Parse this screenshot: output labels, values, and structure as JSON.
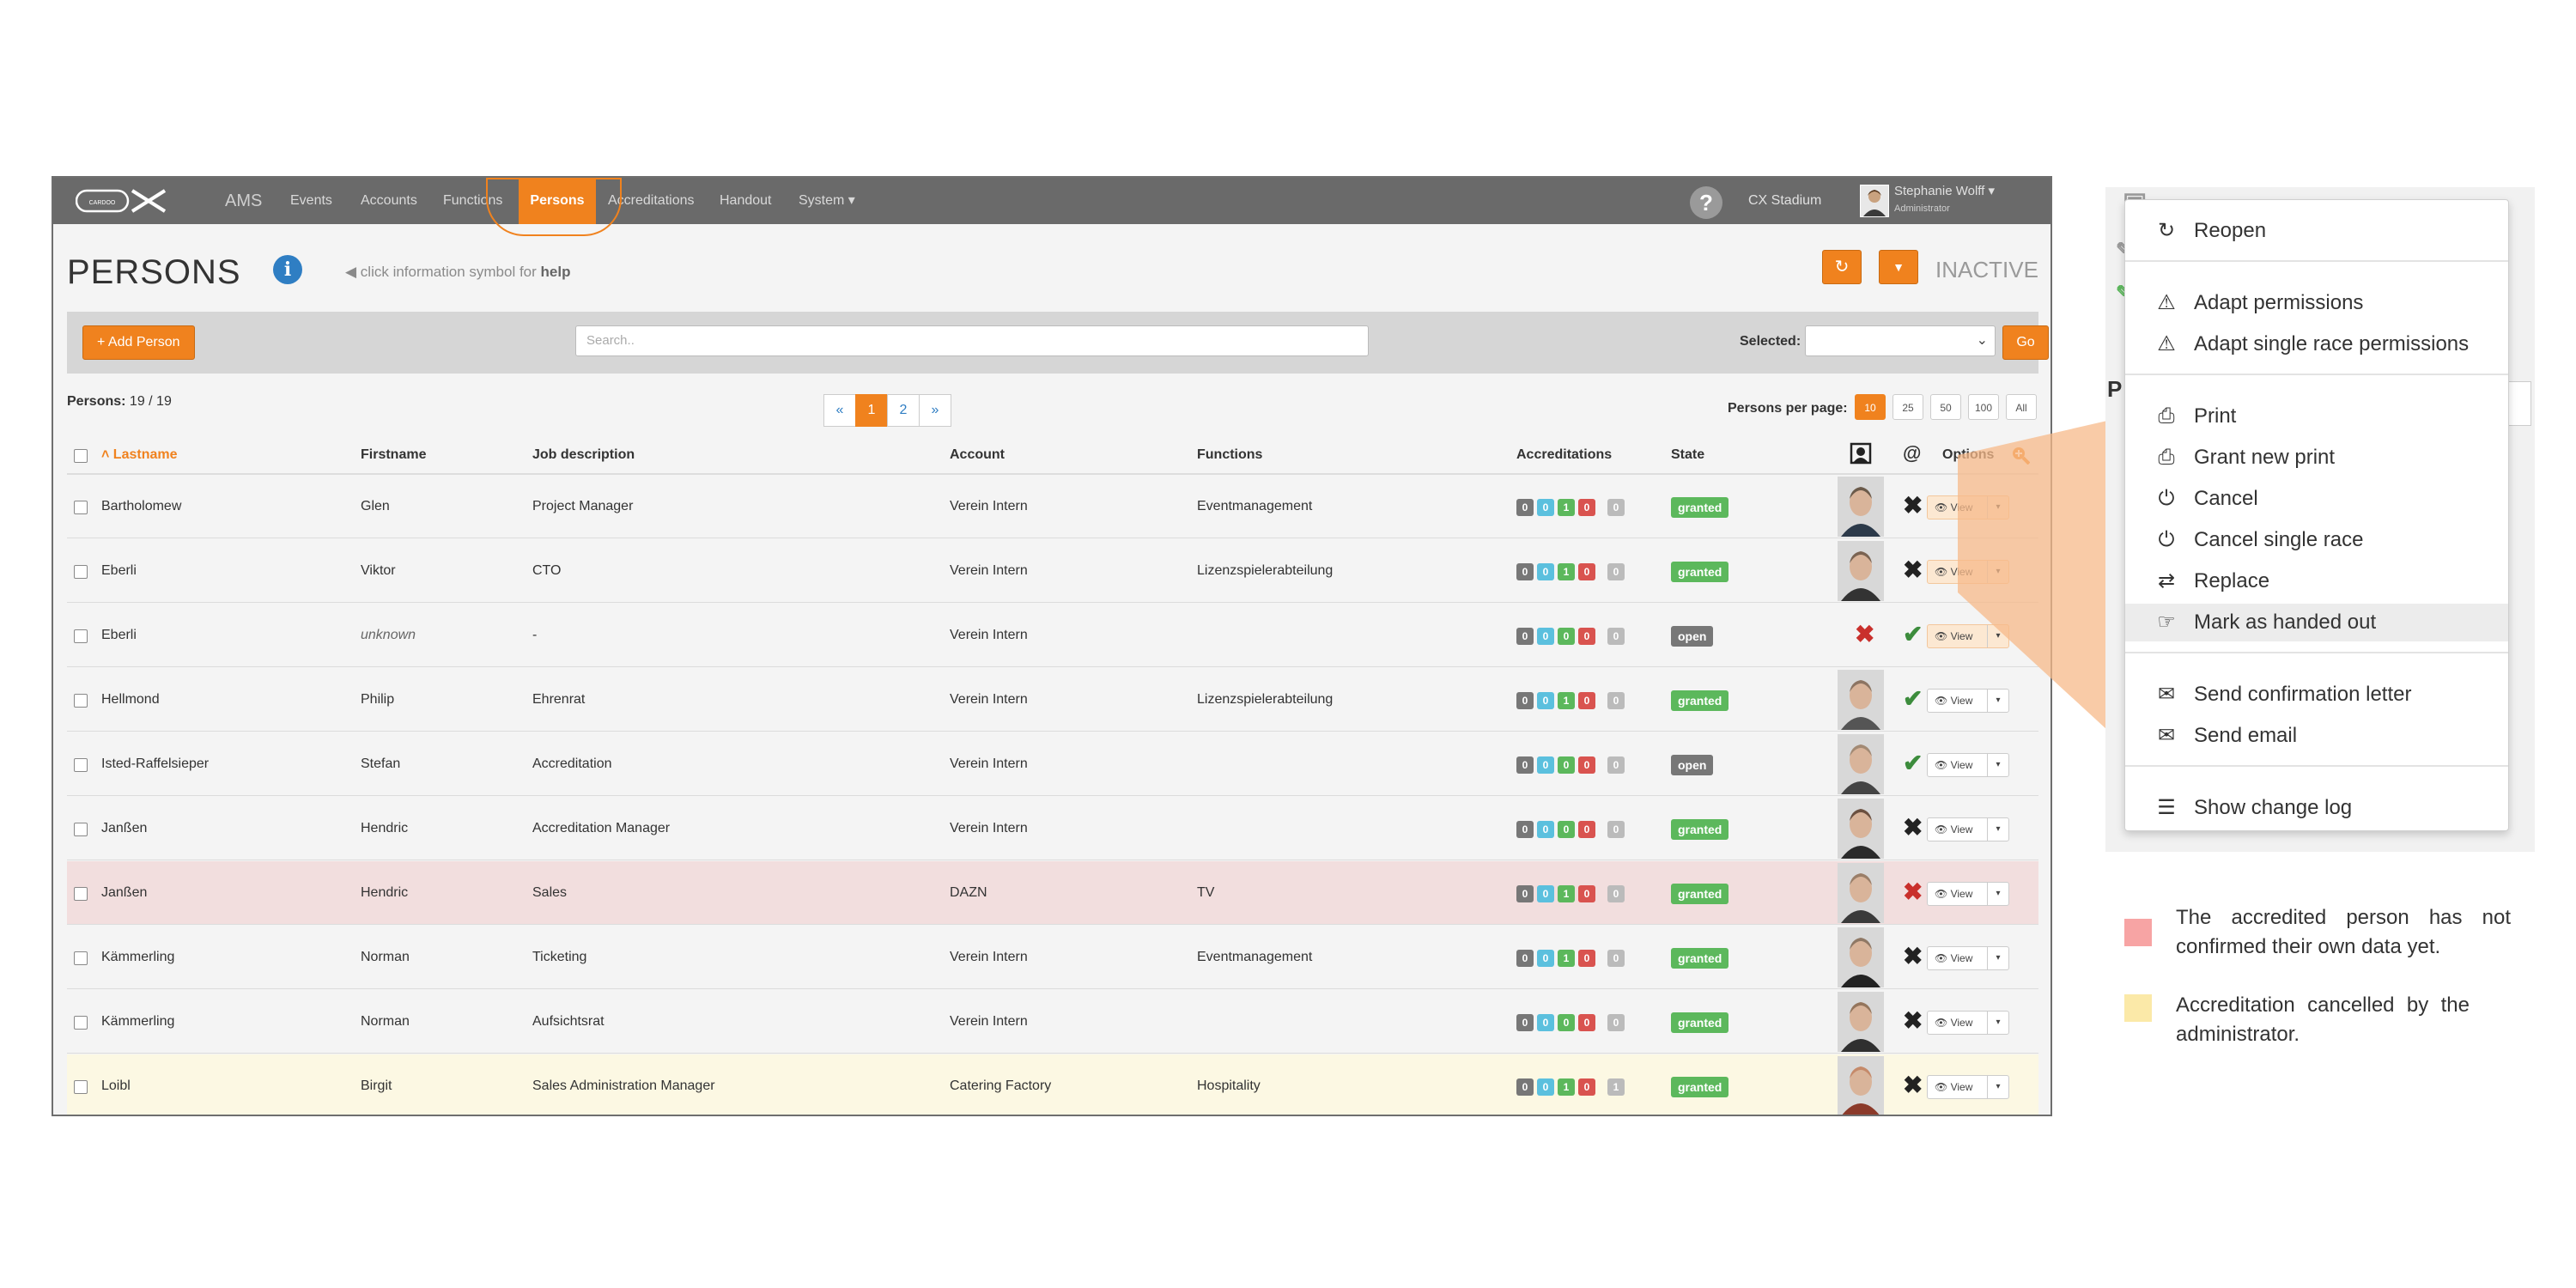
{
  "nav": {
    "items": [
      "AMS",
      "Events",
      "Accounts",
      "Functions",
      "Persons",
      "Accreditations",
      "Handout",
      "System ▾"
    ],
    "help": "?",
    "stadium": "CX Stadium",
    "user_name": "Stephanie Wolff ▾",
    "user_role": "Administrator",
    "accent": "#f0821e"
  },
  "header": {
    "title": "PERSONS",
    "info_icon": "i",
    "hint_prefix": "◀ click information symbol for ",
    "hint_bold": "help",
    "refresh_icon": "↻",
    "filter_icon": "▼",
    "status": "INACTIVE"
  },
  "toolbar": {
    "add_label": "+ Add Person",
    "search_placeholder": "Search..",
    "selected_label": "Selected:",
    "select_caret": "⌄",
    "go_label": "Go"
  },
  "paging": {
    "count_label": "Persons:",
    "count_value": " 19 / 19",
    "pages": [
      "«",
      "1",
      "2",
      "»"
    ],
    "per_page_label": "Persons per page:",
    "per_page_options": [
      "10",
      "25",
      "50",
      "100",
      "All"
    ]
  },
  "columns": {
    "lastname": "˄ Lastname",
    "firstname": "Firstname",
    "job": "Job description",
    "account": "Account",
    "functions": "Functions",
    "accreditations": "Accreditations",
    "state": "State",
    "photo": "person-icon",
    "email": "@",
    "options": "Options"
  },
  "rows": [
    {
      "last": "Bartholomew",
      "first": "Glen",
      "job": "Project Manager",
      "account": "Verein Intern",
      "functions": "Eventmanagement",
      "badges": [
        "0",
        "0",
        "1",
        "0",
        "0"
      ],
      "state": "granted",
      "photo_mark": "",
      "mail_mark": "✖",
      "view": "View",
      "bg": ""
    },
    {
      "last": "Eberli",
      "first": "Viktor",
      "job": "CTO",
      "account": "Verein Intern",
      "functions": "Lizenzspielerabteilung",
      "badges": [
        "0",
        "0",
        "1",
        "0",
        "0"
      ],
      "state": "granted",
      "photo_mark": "",
      "mail_mark": "✖",
      "view": "View",
      "bg": ""
    },
    {
      "last": "Eberli",
      "first": "unknown",
      "job": "-",
      "account": "Verein Intern",
      "functions": "",
      "badges": [
        "0",
        "0",
        "0",
        "0",
        "0"
      ],
      "state": "open",
      "photo_mark": "✖",
      "mail_mark": "✔",
      "view": "View",
      "bg": ""
    },
    {
      "last": "Hellmond",
      "first": "Philip",
      "job": "Ehrenrat",
      "account": "Verein Intern",
      "functions": "Lizenzspielerabteilung",
      "badges": [
        "0",
        "0",
        "1",
        "0",
        "0"
      ],
      "state": "granted",
      "photo_mark": "",
      "mail_mark": "✔",
      "view": "View",
      "bg": ""
    },
    {
      "last": "Isted-Raffelsieper",
      "first": "Stefan",
      "job": "Accreditation",
      "account": "Verein Intern",
      "functions": "",
      "badges": [
        "0",
        "0",
        "0",
        "0",
        "0"
      ],
      "state": "open",
      "photo_mark": "",
      "mail_mark": "✔",
      "view": "View",
      "bg": ""
    },
    {
      "last": "Janßen",
      "first": "Hendric",
      "job": "Accreditation Manager",
      "account": "Verein Intern",
      "functions": "",
      "badges": [
        "0",
        "0",
        "0",
        "0",
        "0"
      ],
      "state": "granted",
      "photo_mark": "",
      "mail_mark": "✖",
      "view": "View",
      "bg": ""
    },
    {
      "last": "Janßen",
      "first": "Hendric",
      "job": "Sales",
      "account": "DAZN",
      "functions": "TV",
      "badges": [
        "0",
        "0",
        "1",
        "0",
        "0"
      ],
      "state": "granted",
      "photo_mark": "",
      "mail_mark": "✖",
      "view": "View",
      "bg": "pink"
    },
    {
      "last": "Kämmerling",
      "first": "Norman",
      "job": "Ticketing",
      "account": "Verein Intern",
      "functions": "Eventmanagement",
      "badges": [
        "0",
        "0",
        "1",
        "0",
        "0"
      ],
      "state": "granted",
      "photo_mark": "",
      "mail_mark": "✖",
      "view": "View",
      "bg": ""
    },
    {
      "last": "Kämmerling",
      "first": "Norman",
      "job": "Aufsichtsrat",
      "account": "Verein Intern",
      "functions": "",
      "badges": [
        "0",
        "0",
        "0",
        "0",
        "0"
      ],
      "state": "granted",
      "photo_mark": "",
      "mail_mark": "✖",
      "view": "View",
      "bg": ""
    },
    {
      "last": "Loibl",
      "first": "Birgit",
      "job": "Sales Administration Manager",
      "account": "Catering Factory",
      "functions": "Hospitality",
      "badges": [
        "0",
        "0",
        "1",
        "0",
        "1"
      ],
      "state": "granted",
      "photo_mark": "",
      "mail_mark": "✖",
      "view": "View",
      "bg": "yellow"
    }
  ],
  "dropdown": {
    "groups": [
      [
        {
          "icon": "↻",
          "label": "Reopen"
        }
      ],
      [
        {
          "icon": "⚠",
          "label": "Adapt permissions"
        },
        {
          "icon": "⚠",
          "label": "Adapt single race permissions"
        }
      ],
      [
        {
          "icon": "⎙",
          "label": "Print"
        },
        {
          "icon": "⎙",
          "label": "Grant new print"
        },
        {
          "icon": "⏻",
          "label": "Cancel"
        },
        {
          "icon": "⏻",
          "label": "Cancel single race"
        },
        {
          "icon": "⇄",
          "label": "Replace"
        },
        {
          "icon": "☞",
          "label": "Mark as handed out"
        }
      ],
      [
        {
          "icon": "✉",
          "label": "Send confirmation letter"
        },
        {
          "icon": "✉",
          "label": "Send email"
        }
      ],
      [
        {
          "icon": "☰",
          "label": "Show change log"
        }
      ]
    ]
  },
  "legend": [
    {
      "color": "#f7a4a4",
      "text": "The accredited person has not confirmed their own data yet."
    },
    {
      "color": "#fbe9a8",
      "text": "Accreditation cancelled by the administrator."
    }
  ]
}
